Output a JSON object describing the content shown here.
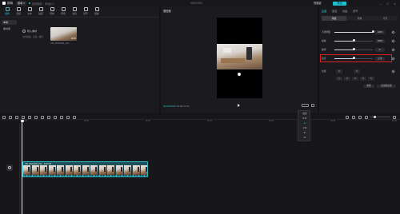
{
  "titlebar": {
    "app_name": "剪映",
    "menu_label": "菜单 ▾",
    "autosave": "自动保存：本地(D:)",
    "project_title": "0000/0000",
    "shortcut": "快捷键",
    "export_label": "导出",
    "window_buttons": [
      "–",
      "□",
      "×"
    ]
  },
  "media": {
    "toolbar": [
      {
        "label": "媒体",
        "icon": "media-icon"
      },
      {
        "label": "音频",
        "icon": "audio-icon"
      },
      {
        "label": "文本",
        "icon": "text-icon"
      },
      {
        "label": "贴纸",
        "icon": "sticker-icon"
      },
      {
        "label": "特效",
        "icon": "effects-icon"
      },
      {
        "label": "转场",
        "icon": "transition-icon"
      },
      {
        "label": "滤镜",
        "icon": "filter-icon"
      },
      {
        "label": "调节",
        "icon": "adjust-icon"
      },
      {
        "label": "模板",
        "icon": "template-icon"
      }
    ],
    "side_nav": [
      "本地",
      "素材库"
    ],
    "import_label": "导入素材",
    "import_hint": "支持视频、音频、图片",
    "clip_name": "VID_20201108_100...",
    "clip_duration": "00:05"
  },
  "player": {
    "title": "播放器",
    "current_time": "00:00:00:00",
    "total_time": "00:00:07:05"
  },
  "properties": {
    "tabs": [
      "画面",
      "变速",
      "动画",
      "调节"
    ],
    "subtabs": [
      "基础",
      "抠像",
      "背景"
    ],
    "rows": [
      {
        "label": "不透明度",
        "value": "100%",
        "level": 1.0
      },
      {
        "label": "缩放",
        "value": "100%",
        "level": 0.5
      },
      {
        "label": "旋转",
        "value": "0°",
        "level": 0.5
      },
      {
        "label": "混合",
        "value": "正常",
        "level": 0.5
      },
      {
        "label": "位置",
        "value": "0",
        "level": 0.5
      }
    ],
    "position_x": "0",
    "position_y": "0",
    "scale_values": [
      "1",
      "2",
      "3",
      "4",
      "5"
    ],
    "reset_label": "重置",
    "apply_label": "应用到全部"
  },
  "timeline": {
    "ticks": [
      "00:00",
      "00:05",
      "00:10",
      "00:15",
      "00:20",
      "00:25",
      "00:30"
    ],
    "clip_title": "VID_20201108_100... 00:07:05"
  },
  "speed_menu": {
    "items": [
      "适应",
      "0.5x",
      "1x",
      "1.5x",
      "2x",
      "3x"
    ],
    "selected_index": 2
  },
  "colors": {
    "accent": "#2fbfd0",
    "highlight": "#e02020"
  }
}
